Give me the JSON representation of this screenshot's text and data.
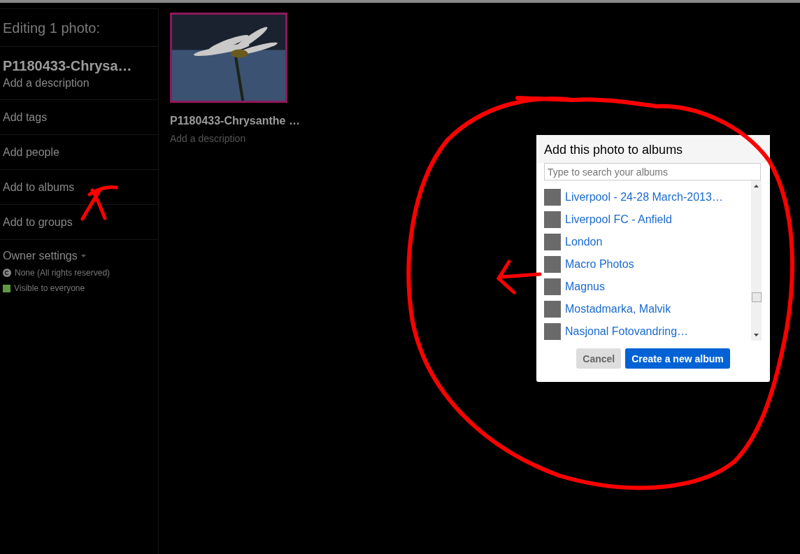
{
  "sidebar": {
    "heading": "Editing 1 photo:",
    "photo_title": "P1180433-Chrysa…",
    "description_link": "Add a description",
    "items": [
      "Add tags",
      "Add people",
      "Add to albums",
      "Add to groups"
    ],
    "owner_settings": {
      "label": "Owner settings",
      "license": "None (All rights reserved)",
      "privacy": "Visible to everyone"
    }
  },
  "photo": {
    "title": "P1180433-Chrysanthe …",
    "description": "Add a description",
    "selected": true
  },
  "dialog": {
    "title": "Add this photo to albums",
    "search": {
      "placeholder": "Type to search your albums"
    },
    "albums": [
      "Liverpool - 24-28 March-2013…",
      "Liverpool FC - Anfield",
      "London",
      "Macro Photos",
      "Magnus",
      "Mostadmarka, Malvik",
      "Nasjonal Fotovandring…"
    ],
    "buttons": [
      {
        "label": "Cancel",
        "kind": "secondary"
      },
      {
        "label": "Create a new album",
        "kind": "primary"
      }
    ]
  }
}
